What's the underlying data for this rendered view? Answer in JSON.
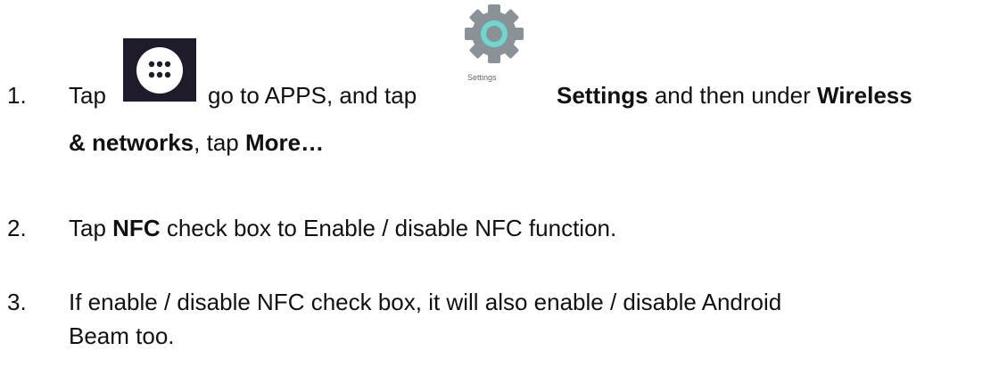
{
  "steps": [
    {
      "number": "1.",
      "tap": "Tap",
      "go_to": "go to APPS, and tap",
      "settings_caption": "Settings",
      "settings_bold": "Settings",
      "and_then_under": "and then under",
      "wireless": "Wireless",
      "networks": "& networks",
      "tap_comma": ", tap",
      "more": "More…"
    },
    {
      "number": "2.",
      "tap": "Tap",
      "nfc": "NFC",
      "rest": "check box to Enable / disable NFC function."
    },
    {
      "number": "3.",
      "line1": "If enable / disable NFC check box, it will also enable / disable Android",
      "line2": "Beam too."
    }
  ],
  "icons": {
    "apps": "apps-grid-icon",
    "settings": "settings-gear-icon"
  },
  "colors": {
    "apps_bg": "#1f1b2b",
    "gear_gray": "#8a9197",
    "gear_teal": "#6fd6d0"
  }
}
